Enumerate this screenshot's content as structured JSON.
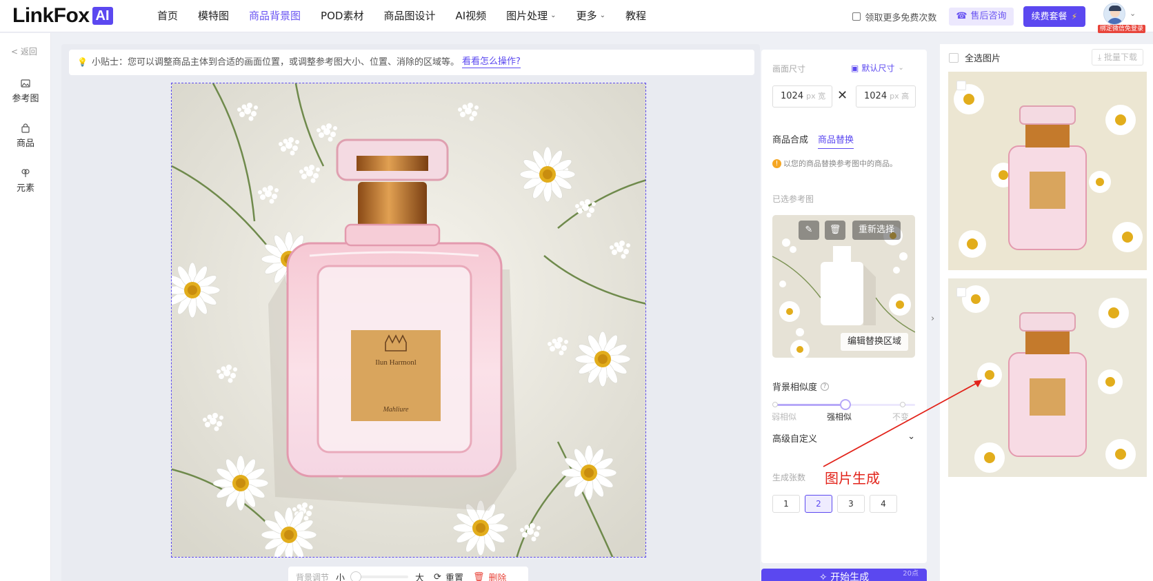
{
  "brand": {
    "logo_text": "LinkFox",
    "logo_badge": "AI"
  },
  "nav": {
    "items": [
      {
        "label": "首页",
        "active": false
      },
      {
        "label": "模特图",
        "active": false
      },
      {
        "label": "商品背景图",
        "active": true
      },
      {
        "label": "POD素材",
        "active": false
      },
      {
        "label": "商品图设计",
        "active": false
      },
      {
        "label": "AI视频",
        "active": false
      },
      {
        "label": "图片处理",
        "active": false,
        "dropdown": true
      },
      {
        "label": "更多",
        "active": false,
        "dropdown": true
      },
      {
        "label": "教程",
        "active": false
      }
    ]
  },
  "header_right": {
    "quota_label": "领取更多免费次数",
    "consult_label": "售后咨询",
    "renew_label": "续费套餐",
    "bind_badge": "绑定微信免登录"
  },
  "sidebar": {
    "back_label": "返回",
    "tools": [
      {
        "label": "参考图",
        "icon": "image-icon"
      },
      {
        "label": "商品",
        "icon": "bag-icon"
      },
      {
        "label": "元素",
        "icon": "flower-icon"
      }
    ]
  },
  "canvas": {
    "tip_text": "小贴士：您可以调整商品主体到合适的画面位置，或调整参考图大小、位置、消除的区域等。",
    "tip_link": "看看怎么操作?",
    "label_text": "Ilun Harmonl",
    "label_sub": "Mahliure",
    "bottom_tools": {
      "bg_adjust_label": "背景调节",
      "small_label": "小",
      "large_label": "大",
      "reset_label": "重置",
      "delete_label": "删除"
    }
  },
  "settings": {
    "size_label": "画面尺寸",
    "size_preset": "默认尺寸",
    "width_value": "1024",
    "width_unit": "px 宽",
    "height_value": "1024",
    "height_unit": "px 高",
    "tabs": [
      {
        "label": "商品合成",
        "active": false
      },
      {
        "label": "商品替换",
        "active": true
      }
    ],
    "hint_text": "以您的商品替换参考图中的商品。",
    "ref_label": "已选参考图",
    "reselect_label": "重新选择",
    "edit_region_label": "编辑替换区域",
    "similarity_label": "背景相似度",
    "similarity_ticks": [
      "弱相似",
      "强相似",
      "不变"
    ],
    "similarity_selected": "强相似",
    "similarity_value": 0.5,
    "advanced_label": "高级自定义",
    "count_label": "生成张数",
    "count_options": [
      "1",
      "2",
      "3",
      "4"
    ],
    "count_selected": "2",
    "generate_label": "开始生成",
    "generate_points": "20点"
  },
  "results": {
    "select_all_label": "全选图片",
    "batch_download_label": "批量下载"
  },
  "annotation": {
    "text": "图片生成"
  },
  "colors": {
    "accent": "#5b48f0",
    "accent_light": "#ece8fd",
    "annotation_red": "#e2231a",
    "perfume_pink": "#f2b6c6",
    "cap_gold": "#c47a2c"
  }
}
